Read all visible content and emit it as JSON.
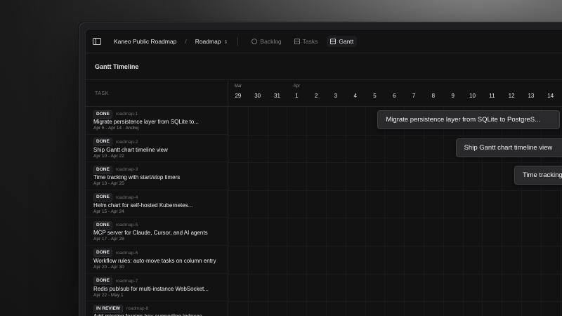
{
  "topbar": {
    "project": "Kaneo Public Roadmap",
    "separator": "/",
    "view_selector": "Roadmap",
    "tabs": [
      {
        "label": "Backlog",
        "icon": "circle-icon"
      },
      {
        "label": "Tasks",
        "icon": "grid-icon"
      },
      {
        "label": "Gantt",
        "icon": "calendar-icon",
        "active": true
      }
    ]
  },
  "section_title": "Gantt Timeline",
  "task_header": "TASK",
  "days": [
    {
      "month": "Mar",
      "num": "29"
    },
    {
      "month": "",
      "num": "30"
    },
    {
      "month": "",
      "num": "31"
    },
    {
      "month": "Apr",
      "num": "1"
    },
    {
      "month": "",
      "num": "2"
    },
    {
      "month": "",
      "num": "3"
    },
    {
      "month": "",
      "num": "4"
    },
    {
      "month": "",
      "num": "5"
    },
    {
      "month": "",
      "num": "6"
    },
    {
      "month": "",
      "num": "7"
    },
    {
      "month": "",
      "num": "8"
    },
    {
      "month": "",
      "num": "9"
    },
    {
      "month": "",
      "num": "10"
    },
    {
      "month": "",
      "num": "11"
    },
    {
      "month": "",
      "num": "12"
    },
    {
      "month": "",
      "num": "13"
    },
    {
      "month": "",
      "num": "14"
    }
  ],
  "tasks": [
    {
      "status": "DONE",
      "slug": "roadmap-1",
      "title": "Migrate persistence layer from SQLite to...",
      "meta": "Apr 6 - Apr 14 · Andrej"
    },
    {
      "status": "DONE",
      "slug": "roadmap-2",
      "title": "Ship Gantt chart timeline view",
      "meta": "Apr 10 - Apr 22"
    },
    {
      "status": "DONE",
      "slug": "roadmap-3",
      "title": "Time tracking with start/stop timers",
      "meta": "Apr 13 - Apr 25"
    },
    {
      "status": "DONE",
      "slug": "roadmap-4",
      "title": "Helm chart for self-hosted Kubernetes...",
      "meta": "Apr 15 - Apr 24"
    },
    {
      "status": "DONE",
      "slug": "roadmap-5",
      "title": "MCP server for Claude, Cursor, and AI agents",
      "meta": "Apr 17 - Apr 28"
    },
    {
      "status": "DONE",
      "slug": "roadmap-6",
      "title": "Workflow rules: auto-move tasks on column entry",
      "meta": "Apr 20 - Apr 30"
    },
    {
      "status": "DONE",
      "slug": "roadmap-7",
      "title": "Redis pub/sub for multi-instance WebSocket...",
      "meta": "Apr 22 - May 1"
    },
    {
      "status": "IN REVIEW",
      "slug": "roadmap-8",
      "title": "Add missing foreign-key supporting indexes",
      "meta": ""
    }
  ],
  "bars": [
    {
      "label": "Migrate persistence layer from SQLite to PostgreS...",
      "start_day": "6",
      "row": 0
    },
    {
      "label": "Ship Gantt chart timeline view",
      "start_day": "10",
      "row": 1
    },
    {
      "label": "Time tracking with start/stop timers",
      "start_day": "13",
      "row": 2
    }
  ]
}
